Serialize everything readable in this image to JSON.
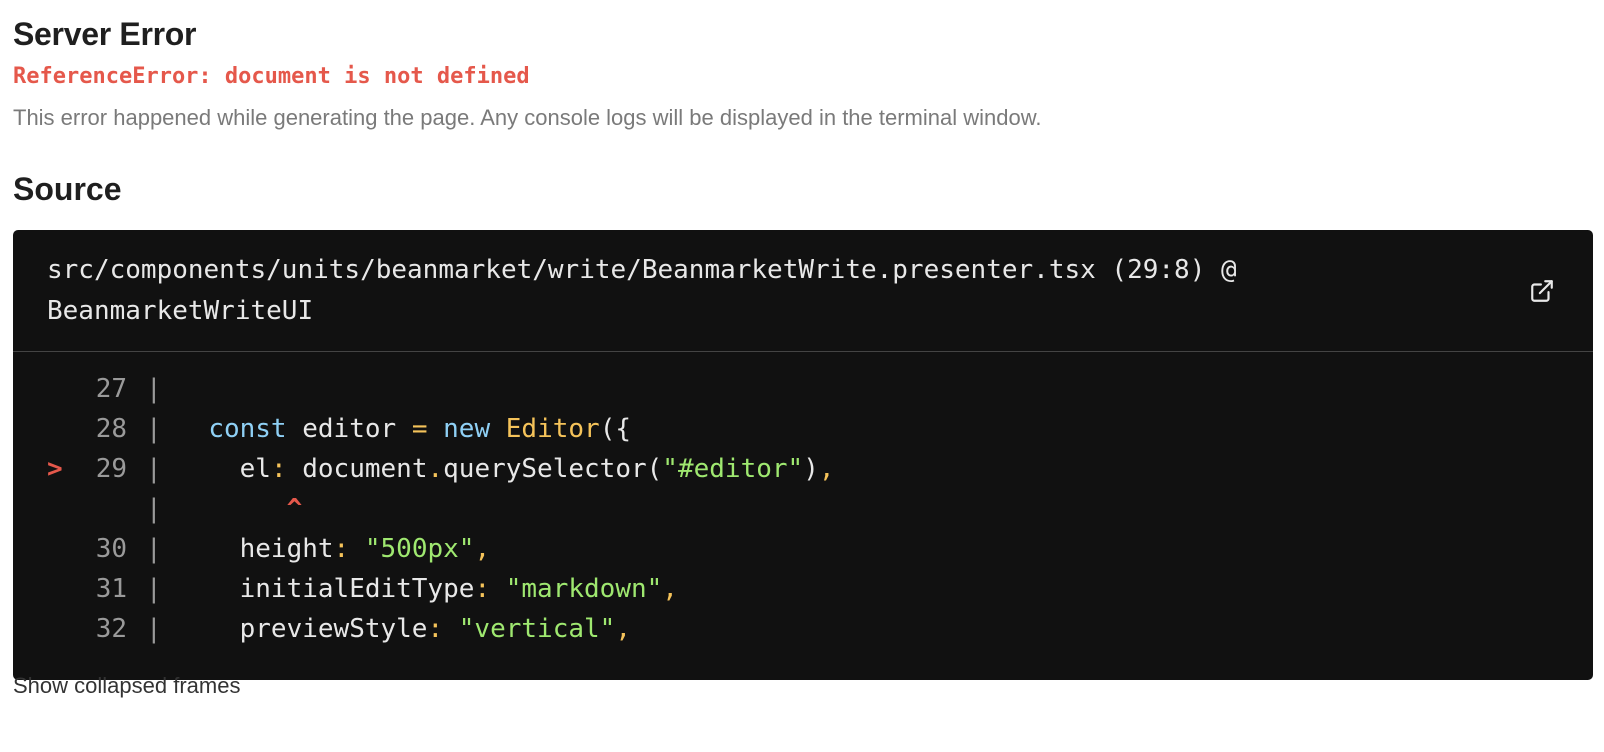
{
  "error": {
    "heading": "Server Error",
    "message": "ReferenceError: document is not defined",
    "description": "This error happened while generating the page. Any console logs will be displayed in the terminal window."
  },
  "source": {
    "heading": "Source",
    "file_path": "src/components/units/beanmarket/write/BeanmarketWrite.presenter.tsx (29:8) @ BeanmarketWriteUI",
    "open_icon": "external-link-icon",
    "error_marker": ">",
    "caret": "^",
    "pipe": "|",
    "lines": [
      {
        "num": "27",
        "indent": "",
        "tokens": []
      },
      {
        "num": "28",
        "indent": "  ",
        "tokens": [
          {
            "t": "const",
            "c": "kw"
          },
          {
            "t": " editor ",
            "c": "txt"
          },
          {
            "t": "=",
            "c": "op"
          },
          {
            "t": " ",
            "c": "txt"
          },
          {
            "t": "new",
            "c": "kw"
          },
          {
            "t": " ",
            "c": "txt"
          },
          {
            "t": "Editor",
            "c": "fn"
          },
          {
            "t": "({",
            "c": "txt"
          }
        ]
      },
      {
        "num": "29",
        "indent": "    ",
        "tokens": [
          {
            "t": "el",
            "c": "txt"
          },
          {
            "t": ":",
            "c": "op"
          },
          {
            "t": " document",
            "c": "txt"
          },
          {
            "t": ".",
            "c": "op"
          },
          {
            "t": "querySelector(",
            "c": "txt"
          },
          {
            "t": "\"#editor\"",
            "c": "str"
          },
          {
            "t": ")",
            "c": "txt"
          },
          {
            "t": ",",
            "c": "op"
          }
        ]
      },
      {
        "num": "30",
        "indent": "    ",
        "tokens": [
          {
            "t": "height",
            "c": "txt"
          },
          {
            "t": ":",
            "c": "op"
          },
          {
            "t": " ",
            "c": "txt"
          },
          {
            "t": "\"500px\"",
            "c": "str"
          },
          {
            "t": ",",
            "c": "op"
          }
        ]
      },
      {
        "num": "31",
        "indent": "    ",
        "tokens": [
          {
            "t": "initialEditType",
            "c": "txt"
          },
          {
            "t": ":",
            "c": "op"
          },
          {
            "t": " ",
            "c": "txt"
          },
          {
            "t": "\"markdown\"",
            "c": "str"
          },
          {
            "t": ",",
            "c": "op"
          }
        ]
      },
      {
        "num": "32",
        "indent": "    ",
        "tokens": [
          {
            "t": "previewStyle",
            "c": "txt"
          },
          {
            "t": ":",
            "c": "op"
          },
          {
            "t": " ",
            "c": "txt"
          },
          {
            "t": "\"vertical\"",
            "c": "str"
          },
          {
            "t": ",",
            "c": "op"
          }
        ]
      }
    ]
  },
  "show_collapsed_frames": "Show collapsed frames",
  "colors": {
    "error_red": "#e5584b",
    "code_bg": "#111111",
    "keyword": "#8fd0f5",
    "function": "#f5c35a",
    "string": "#9fe870"
  }
}
